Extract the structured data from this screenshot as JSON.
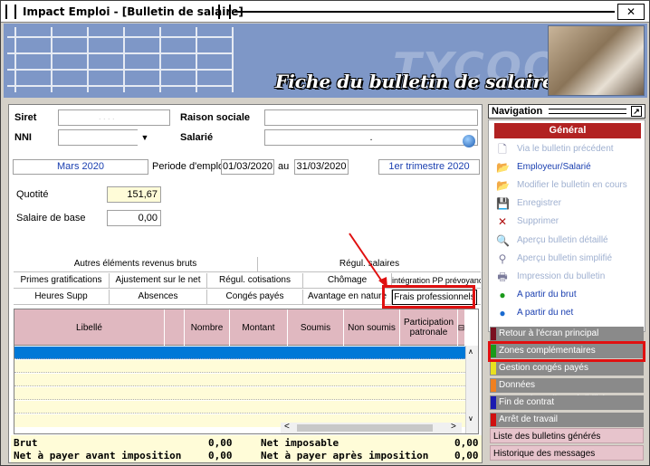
{
  "window": {
    "title": "Impact Emploi - [Bulletin de salaire]",
    "close_label": "✕"
  },
  "banner": {
    "title": "Fiche du bulletin de salaire",
    "brand": "TYCOON"
  },
  "form": {
    "siret_label": "Siret",
    "siret_value": ". . . .",
    "raison_label": "Raison sociale",
    "raison_value": "",
    "nni_label": "NNI",
    "nni_value": "",
    "salarie_label": "Salarié",
    "salarie_value": ".",
    "month": "Mars 2020",
    "periode_label": "Periode d'emploi",
    "date_from": "01/03/2020",
    "au_label": "au",
    "date_to": "31/03/2020",
    "trimestre": "1er trimestre 2020",
    "quotite_label": "Quotité",
    "quotite_value": "151,67",
    "salaire_label": "Salaire de base",
    "salaire_value": "0,00"
  },
  "tabs": {
    "row1": [
      "Autres éléments revenus bruts",
      "Régul. salaires"
    ],
    "row2": [
      "Primes gratifications",
      "Ajustement sur le net",
      "Régul. cotisations",
      "Chômage",
      "intégration PP prévoyance"
    ],
    "row3": [
      "Heures Supp",
      "Absences",
      "Congés payés",
      "Avantage en nature",
      "Frais professionnels"
    ]
  },
  "grid": {
    "headers": [
      "Libellé",
      "",
      "Nombre",
      "Montant",
      "Soumis",
      "Non soumis",
      "Participation patronale"
    ]
  },
  "totals": {
    "brut_label": "Brut",
    "brut_value": "0,00",
    "net_imposable_label": "Net imposable",
    "net_imposable_value": "0,00",
    "net_avant_label": "Net à payer avant imposition",
    "net_avant_value": "0,00",
    "net_apres_label": "Net à payer après imposition",
    "net_apres_value": "0,00"
  },
  "nav": {
    "title": "Navigation",
    "section": "Général",
    "items": [
      {
        "label": "Via le bulletin précédent",
        "enabled": false,
        "icon": "document-icon"
      },
      {
        "label": "Employeur/Salarié",
        "enabled": true,
        "icon": "folder-icon"
      },
      {
        "label": "Modifier le bulletin en cours",
        "enabled": false,
        "icon": "folder-icon"
      },
      {
        "label": "Enregistrer",
        "enabled": false,
        "icon": "save-icon"
      },
      {
        "label": "Supprimer",
        "enabled": false,
        "icon": "delete-icon"
      },
      {
        "label": "Aperçu bulletin détaillé",
        "enabled": false,
        "icon": "preview-icon"
      },
      {
        "label": "Aperçu bulletin simplifié",
        "enabled": false,
        "icon": "magnifier-icon"
      },
      {
        "label": "Impression du bulletin",
        "enabled": false,
        "icon": "printer-icon"
      },
      {
        "label": "A partir du brut",
        "enabled": true,
        "icon": "green-circle-icon"
      },
      {
        "label": "A partir du net",
        "enabled": true,
        "icon": "blue-circle-icon"
      }
    ],
    "zones": [
      {
        "label": "Retour à l'écran principal",
        "color": "#7a1020"
      },
      {
        "label": "Zones complémentaires",
        "color": "#1a9a1a"
      },
      {
        "label": "Gestion congés payés",
        "color": "#e8e020"
      },
      {
        "label": "Données conventionnelles,Pénibilité",
        "color": "#f08020"
      },
      {
        "label": "Fin de contrat",
        "color": "#1a1ab0"
      },
      {
        "label": "Arrêt de travail",
        "color": "#d01010"
      }
    ],
    "list_label": "Liste des bulletins générés",
    "history_label": "Historique des messages"
  }
}
